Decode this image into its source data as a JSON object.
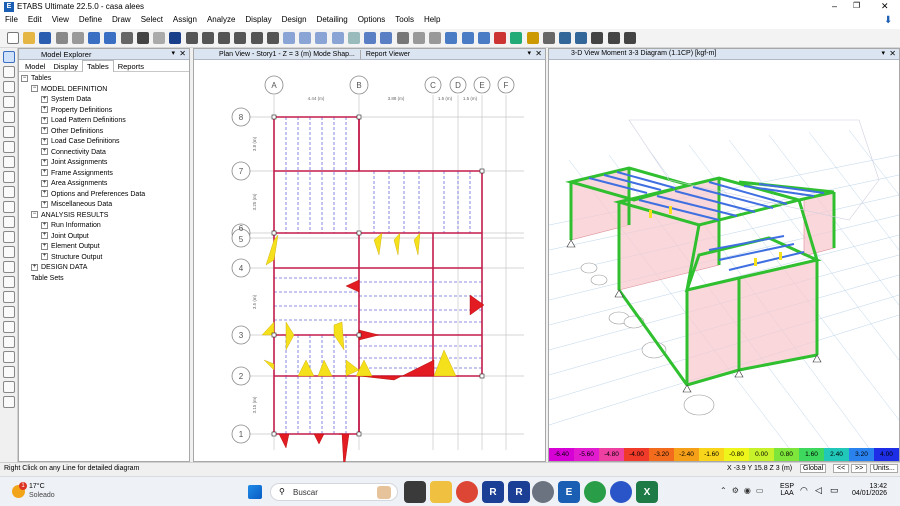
{
  "app": {
    "title": "ETABS Ultimate 22.5.0 - casa alees",
    "icon_letter": "E",
    "window_controls": [
      "–",
      "❐",
      "✕"
    ]
  },
  "menu": [
    "File",
    "Edit",
    "View",
    "Define",
    "Draw",
    "Select",
    "Assign",
    "Analyze",
    "Display",
    "Design",
    "Detailing",
    "Options",
    "Tools",
    "Help"
  ],
  "explorer": {
    "title": "Model Explorer",
    "tabs": [
      "Model",
      "Display",
      "Tables",
      "Reports"
    ],
    "active_tab": "Tables",
    "tree": [
      {
        "level": 0,
        "sign": "−",
        "label": "Tables"
      },
      {
        "level": 1,
        "sign": "−",
        "label": "MODEL DEFINITION"
      },
      {
        "level": 2,
        "sign": "+",
        "label": "System Data"
      },
      {
        "level": 2,
        "sign": "+",
        "label": "Property Definitions"
      },
      {
        "level": 2,
        "sign": "+",
        "label": "Load Pattern Definitions"
      },
      {
        "level": 2,
        "sign": "+",
        "label": "Other Definitions"
      },
      {
        "level": 2,
        "sign": "+",
        "label": "Load Case Definitions"
      },
      {
        "level": 2,
        "sign": "+",
        "label": "Connectivity Data"
      },
      {
        "level": 2,
        "sign": "+",
        "label": "Joint Assignments"
      },
      {
        "level": 2,
        "sign": "+",
        "label": "Frame Assignments"
      },
      {
        "level": 2,
        "sign": "+",
        "label": "Area Assignments"
      },
      {
        "level": 2,
        "sign": "+",
        "label": "Options and Preferences Data"
      },
      {
        "level": 2,
        "sign": "+",
        "label": "Miscellaneous Data"
      },
      {
        "level": 1,
        "sign": "−",
        "label": "ANALYSIS RESULTS"
      },
      {
        "level": 2,
        "sign": "+",
        "label": "Run Information"
      },
      {
        "level": 2,
        "sign": "+",
        "label": "Joint Output"
      },
      {
        "level": 2,
        "sign": "+",
        "label": "Element Output"
      },
      {
        "level": 2,
        "sign": "+",
        "label": "Structure Output"
      },
      {
        "level": 1,
        "sign": "+",
        "label": "DESIGN DATA"
      },
      {
        "level": 0,
        "sign": "",
        "label": "Table Sets"
      }
    ]
  },
  "plan": {
    "tabs": [
      "Plan View - Story1 - Z = 3 (m)  Mode Shap...",
      "Report Viewer"
    ],
    "col_bubbles": [
      "A",
      "B",
      "C",
      "D",
      "E",
      "F"
    ],
    "row_bubbles": [
      "8",
      "7",
      "6",
      "5",
      "4",
      "3",
      "2",
      "1"
    ],
    "dims_top": [
      "4.44 (m)",
      "3.88 (m)",
      "1.5 (m)",
      "1.5 (m)"
    ],
    "dims_left": [
      "3.8 (m)",
      "3.25 (m)",
      "3.5 (m)",
      "3.15 (m)"
    ]
  },
  "view3d": {
    "title": "3-D View   Moment 3-3 Diagram   (1.1CP)  [kgf-m]",
    "scale": [
      "-6.40",
      "-5.60",
      "-4.80",
      "-4.00",
      "-3.20",
      "-2.40",
      "-1.60",
      "-0.80",
      "0.00",
      "0.80",
      "1.60",
      "2.40",
      "3.20",
      "4.00"
    ],
    "scale_colors": [
      "#d600d6",
      "#e31bd0",
      "#ee3fa2",
      "#f03a2a",
      "#f36c1d",
      "#f6a01a",
      "#f8d41b",
      "#eef51a",
      "#c7f12a",
      "#7ee63a",
      "#3ed85e",
      "#21c7b9",
      "#2a82ef",
      "#1d2ee6"
    ]
  },
  "status": {
    "hint": "Right Click on any Line for detailed diagram",
    "coords": "X -3.9  Y 15.8  Z 3 (m)",
    "global": "Global",
    "units": "Units..."
  },
  "taskbar": {
    "weather_temp": "17°C",
    "weather_desc": "Soleado",
    "weather_badge": "1",
    "search": "Buscar",
    "lang1": "ESP",
    "lang2": "LAA",
    "time": "13:42",
    "date": "04/01/2026"
  }
}
